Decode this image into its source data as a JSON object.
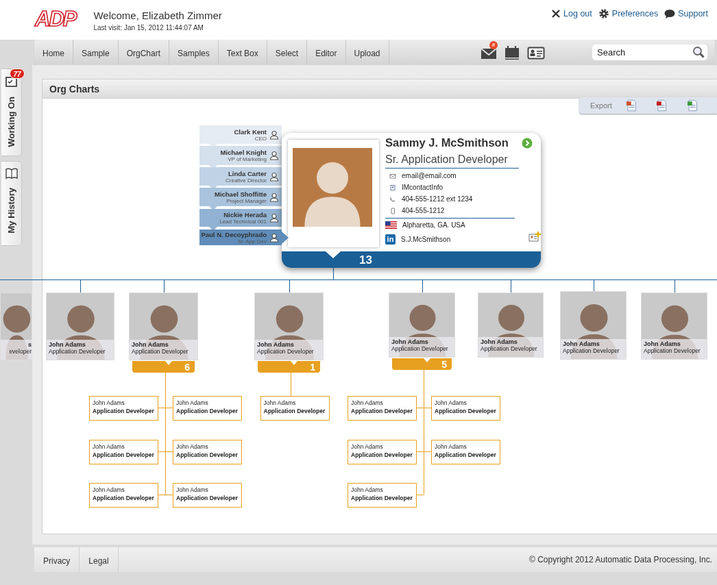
{
  "header": {
    "logo": "ADP",
    "welcome": "Welcome, Elizabeth Zimmer",
    "last_visit": "Last visit: Jan 15, 2012 11:44:07 AM"
  },
  "top_links": [
    {
      "kind": "logout",
      "label": "Log out"
    },
    {
      "kind": "preferences",
      "label": "Preferences"
    },
    {
      "kind": "support",
      "label": "Support"
    }
  ],
  "nav": {
    "items": [
      "Home",
      "Sample",
      "OrgChart",
      "Samples",
      "Text Box",
      "Select",
      "Editor",
      "Upload"
    ],
    "mail_badge": "#",
    "search": {
      "placeholder": "Search"
    }
  },
  "side_tabs": [
    {
      "kind": "tasks",
      "label": "Working On",
      "badge": "77"
    },
    {
      "kind": "history",
      "label": "My History"
    }
  ],
  "panel": {
    "title": "Org Charts",
    "export_label": "Export"
  },
  "chain": [
    {
      "name": "Clark Kent",
      "role": "CEO",
      "selected": false
    },
    {
      "name": "Michael Knight",
      "role": "VP of Marketing",
      "selected": false
    },
    {
      "name": "Linda Carter",
      "role": "Creative Director",
      "selected": false
    },
    {
      "name": "Michael Shoffitte",
      "role": "Project Manager",
      "selected": false
    },
    {
      "name": "Nickie Herada",
      "role": "Lead Technical 001",
      "selected": false
    },
    {
      "name": "Paul N. Decoyphrado",
      "role": "Sr. App Dev",
      "selected": true
    }
  ],
  "profile": {
    "name": "Sammy J. McSmithson",
    "title": "Sr. Application Developer",
    "email": "email@email.com",
    "im": "IMcontactInfo",
    "phone": "404-555-1212 ext 1234",
    "mobile": "404-555-1212",
    "location": "Alpharetta, GA. USA",
    "linkedin_mark": "in",
    "linkedin": "S.J.McSmithson",
    "count": "13"
  },
  "team": [
    {
      "name": "s",
      "title": "eveloper"
    },
    {
      "name": "John Adams",
      "title": "Application Developer"
    },
    {
      "name": "John Adams",
      "title": "Application Developer",
      "count": "6",
      "children": [
        {
          "name": "John Adams",
          "title": "Application Developer"
        },
        {
          "name": "John Adams",
          "title": "Application Developer"
        },
        {
          "name": "John Adams",
          "title": "Application Developer"
        },
        {
          "name": "John Adams",
          "title": "Application Developer"
        },
        {
          "name": "John Adams",
          "title": "Application Developer"
        },
        {
          "name": "John Adams",
          "title": "Application Developer"
        }
      ]
    },
    {
      "name": "John Adams",
      "title": "Application Developer",
      "count": "1",
      "children": [
        {
          "name": "John Adams",
          "title": "Application Developer"
        }
      ]
    },
    {
      "name": "John Adams",
      "title": "Application Developer",
      "count": "5",
      "children": [
        {
          "name": "John Adams",
          "title": "Application Developer"
        },
        {
          "name": "John Adams",
          "title": "Application Developer"
        },
        {
          "name": "John Adams",
          "title": "Application Developer"
        },
        {
          "name": "John Adams",
          "title": "Application Developer"
        },
        {
          "name": "John Adams",
          "title": "Application Developer"
        }
      ]
    },
    {
      "name": "John Adams",
      "title": "Application Developer"
    },
    {
      "name": "John Adams",
      "title": "Application Developer"
    },
    {
      "name": "John Adams",
      "title": "Application Developer"
    }
  ],
  "footer": {
    "links": [
      "Privacy",
      "Legal"
    ],
    "copyright": "© Copyright 2012 Automatic Data Processing, Inc."
  }
}
